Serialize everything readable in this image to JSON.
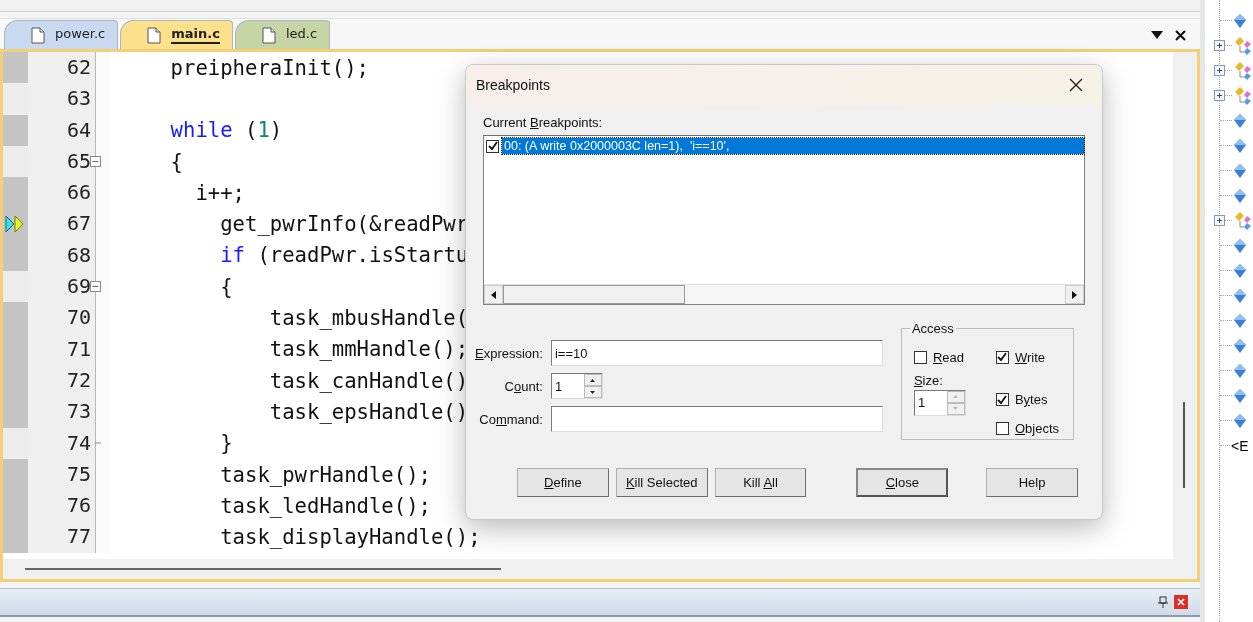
{
  "tabs": [
    {
      "label": "power.c",
      "selected": false,
      "color": "#c9d9f2"
    },
    {
      "label": "main.c",
      "selected": true,
      "color": "#fde08c"
    },
    {
      "label": "led.c",
      "selected": false,
      "color": "#c6d5a6"
    }
  ],
  "editor": {
    "lines": [
      {
        "number": "62",
        "kind": "code",
        "executable": true,
        "current": false,
        "code": [
          {
            "kind": "plain",
            "text": "    preipheraInit();"
          }
        ]
      },
      {
        "number": "63",
        "kind": "blank",
        "executable": false,
        "current": false
      },
      {
        "number": "64",
        "kind": "code",
        "executable": true,
        "current": false,
        "code": [
          {
            "kind": "keyword",
            "text": "    while"
          },
          {
            "kind": "plain",
            "text": " ("
          },
          {
            "kind": "number",
            "text": "1"
          },
          {
            "kind": "plain",
            "text": ")"
          }
        ]
      },
      {
        "number": "65",
        "kind": "fold_start",
        "executable": false,
        "current": false,
        "code": [
          {
            "kind": "plain",
            "text": "    {"
          }
        ]
      },
      {
        "number": "66",
        "kind": "code",
        "executable": true,
        "current": false,
        "code": [
          {
            "kind": "plain",
            "text": "      i++;"
          }
        ]
      },
      {
        "number": "67",
        "kind": "code",
        "executable": true,
        "current": true,
        "code": [
          {
            "kind": "plain",
            "text": "        get_pwrInfo(&readPwr"
          }
        ]
      },
      {
        "number": "68",
        "kind": "code",
        "executable": true,
        "current": false,
        "code": [
          {
            "kind": "keyword",
            "text": "        if"
          },
          {
            "kind": "plain",
            "text": " (readPwr.isStartu"
          }
        ]
      },
      {
        "number": "69",
        "kind": "fold_start",
        "executable": false,
        "current": false,
        "code": [
          {
            "kind": "plain",
            "text": "        {"
          }
        ]
      },
      {
        "number": "70",
        "kind": "code",
        "executable": true,
        "current": false,
        "code": [
          {
            "kind": "plain",
            "text": "            task_mbusHandle("
          }
        ]
      },
      {
        "number": "71",
        "kind": "code",
        "executable": true,
        "current": false,
        "code": [
          {
            "kind": "plain",
            "text": "            task_mmHandle();"
          }
        ]
      },
      {
        "number": "72",
        "kind": "code",
        "executable": true,
        "current": false,
        "code": [
          {
            "kind": "plain",
            "text": "            task_canHandle()"
          }
        ]
      },
      {
        "number": "73",
        "kind": "code",
        "executable": true,
        "current": false,
        "code": [
          {
            "kind": "plain",
            "text": "            task_epsHandle()"
          }
        ]
      },
      {
        "number": "74",
        "kind": "fold_end",
        "executable": false,
        "current": false,
        "code": [
          {
            "kind": "plain",
            "text": "        }"
          }
        ]
      },
      {
        "number": "75",
        "kind": "code",
        "executable": true,
        "current": false,
        "code": [
          {
            "kind": "plain",
            "text": "        task_pwrHandle();"
          }
        ]
      },
      {
        "number": "76",
        "kind": "code",
        "executable": true,
        "current": false,
        "code": [
          {
            "kind": "plain",
            "text": "        task_ledHandle();"
          }
        ]
      },
      {
        "number": "77",
        "kind": "code",
        "executable": true,
        "current": false,
        "code": [
          {
            "kind": "plain",
            "text": "        task_displayHandle();"
          }
        ]
      }
    ]
  },
  "symbols_tree": {
    "items": [
      {
        "kind": "variable"
      },
      {
        "kind": "struct",
        "expanded": false
      },
      {
        "kind": "struct",
        "expanded": false
      },
      {
        "kind": "struct",
        "expanded": false
      },
      {
        "kind": "variable"
      },
      {
        "kind": "variable"
      },
      {
        "kind": "variable"
      },
      {
        "kind": "variable"
      },
      {
        "kind": "struct",
        "expanded": false
      },
      {
        "kind": "variable"
      },
      {
        "kind": "variable"
      },
      {
        "kind": "variable"
      },
      {
        "kind": "variable"
      },
      {
        "kind": "variable"
      },
      {
        "kind": "variable"
      },
      {
        "kind": "variable"
      },
      {
        "kind": "variable"
      },
      {
        "kind": "text",
        "label": "<E"
      }
    ]
  },
  "dialog": {
    "title": "Breakpoints",
    "list_label": {
      "pre": "Current ",
      "key": "B",
      "post": "reakpoints:"
    },
    "breakpoints": [
      {
        "text": "00: (A write 0x2000003C len=1),  'i==10',",
        "checked": true,
        "selected": true
      }
    ],
    "expression": {
      "label": {
        "key": "E",
        "post": "xpression:"
      },
      "value": "i==10"
    },
    "count": {
      "label": {
        "pre": "C",
        "key": "o",
        "post": "unt:"
      },
      "value": "1",
      "arrows_disabled": false
    },
    "command": {
      "label": {
        "pre": "Co",
        "key": "m",
        "post": "mand:"
      }
    },
    "access": {
      "title": "Access",
      "read": {
        "label": {
          "key": "R",
          "post": "ead"
        },
        "checked": false
      },
      "write": {
        "label": {
          "key": "W",
          "post": "rite"
        },
        "checked": true
      },
      "size": {
        "label": {
          "key": "S",
          "post": "ize:"
        },
        "value": "1",
        "arrows_disabled": true
      },
      "bytes": {
        "label": {
          "pre": "B",
          "key": "y",
          "post": "tes"
        },
        "checked": true
      },
      "objects": {
        "label": {
          "key": "O",
          "post": "bjects"
        },
        "checked": false
      }
    },
    "buttons": [
      {
        "label": {
          "key": "D",
          "post": "efine"
        },
        "default": false
      },
      {
        "label": {
          "key": "K",
          "post": "ill Selected"
        },
        "default": false
      },
      {
        "label": {
          "pre": "Kill ",
          "key": "A",
          "post": "ll"
        },
        "default": false
      },
      {
        "label": {
          "key": "C",
          "post": "lose"
        },
        "default": true
      },
      {
        "label": "Help",
        "default": false
      }
    ]
  }
}
